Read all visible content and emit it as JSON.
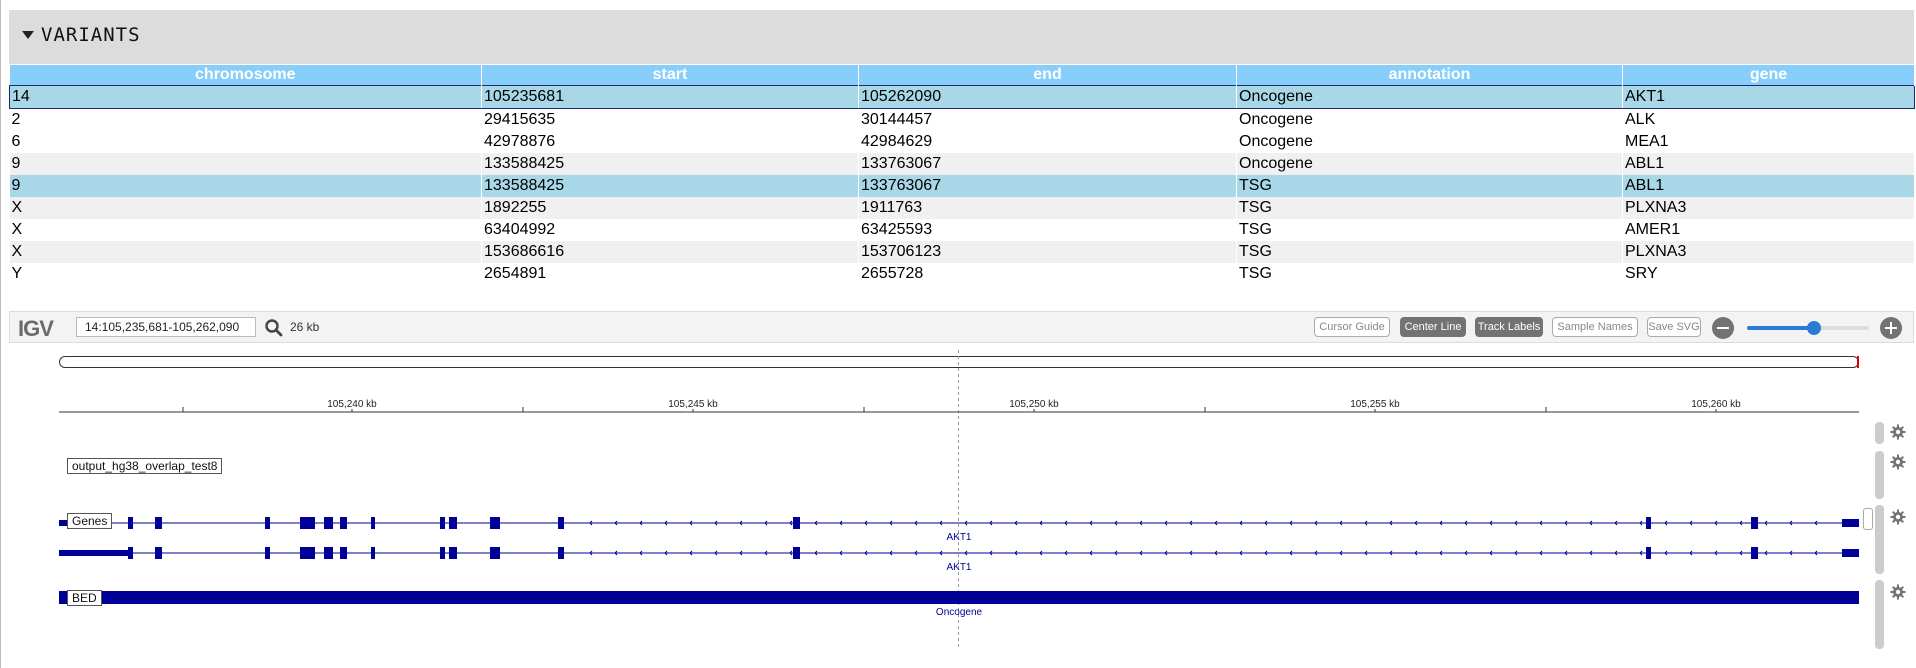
{
  "variants": {
    "title": "VARIANTS",
    "columns": [
      "chromosome",
      "start",
      "end",
      "annotation",
      "gene"
    ],
    "rows": [
      [
        "14",
        "105235681",
        "105262090",
        "Oncogene",
        "AKT1"
      ],
      [
        "2",
        "29415635",
        "30144457",
        "Oncogene",
        "ALK"
      ],
      [
        "6",
        "42978876",
        "42984629",
        "Oncogene",
        "MEA1"
      ],
      [
        "9",
        "133588425",
        "133763067",
        "Oncogene",
        "ABL1"
      ],
      [
        "9",
        "133588425",
        "133763067",
        "TSG",
        "ABL1"
      ],
      [
        "X",
        "1892255",
        "1911763",
        "TSG",
        "PLXNA3"
      ],
      [
        "X",
        "63404992",
        "63425593",
        "TSG",
        "AMER1"
      ],
      [
        "X",
        "153686616",
        "153706123",
        "TSG",
        "PLXNA3"
      ],
      [
        "Y",
        "2654891",
        "2655728",
        "TSG",
        "SRY"
      ]
    ]
  },
  "igv": {
    "logo": "IGV",
    "locus": "14:105,235,681-105,262,090",
    "span": "26 kb",
    "buttons": {
      "cursor_guide": "Cursor Guide",
      "center_line": "Center Line",
      "track_labels": "Track Labels",
      "sample_names": "Sample Names",
      "save_svg": "Save SVG"
    },
    "zoom_level": 0.55,
    "ruler_ticks": [
      "105,240 kb",
      "105,245 kb",
      "105,250 kb",
      "105,255 kb",
      "105,260 kb"
    ],
    "tracks": {
      "output_label": "output_hg38_overlap_test8",
      "genes_label": "Genes",
      "gene_name_1": "AKT1",
      "gene_name_2": "AKT1",
      "bed_label": "BED",
      "bed_feature": "Oncogene"
    }
  },
  "colors": {
    "table_header": "#87cefa",
    "selected_row": "#a8d8e8",
    "feature": "#000096",
    "button_on": "#737373"
  }
}
